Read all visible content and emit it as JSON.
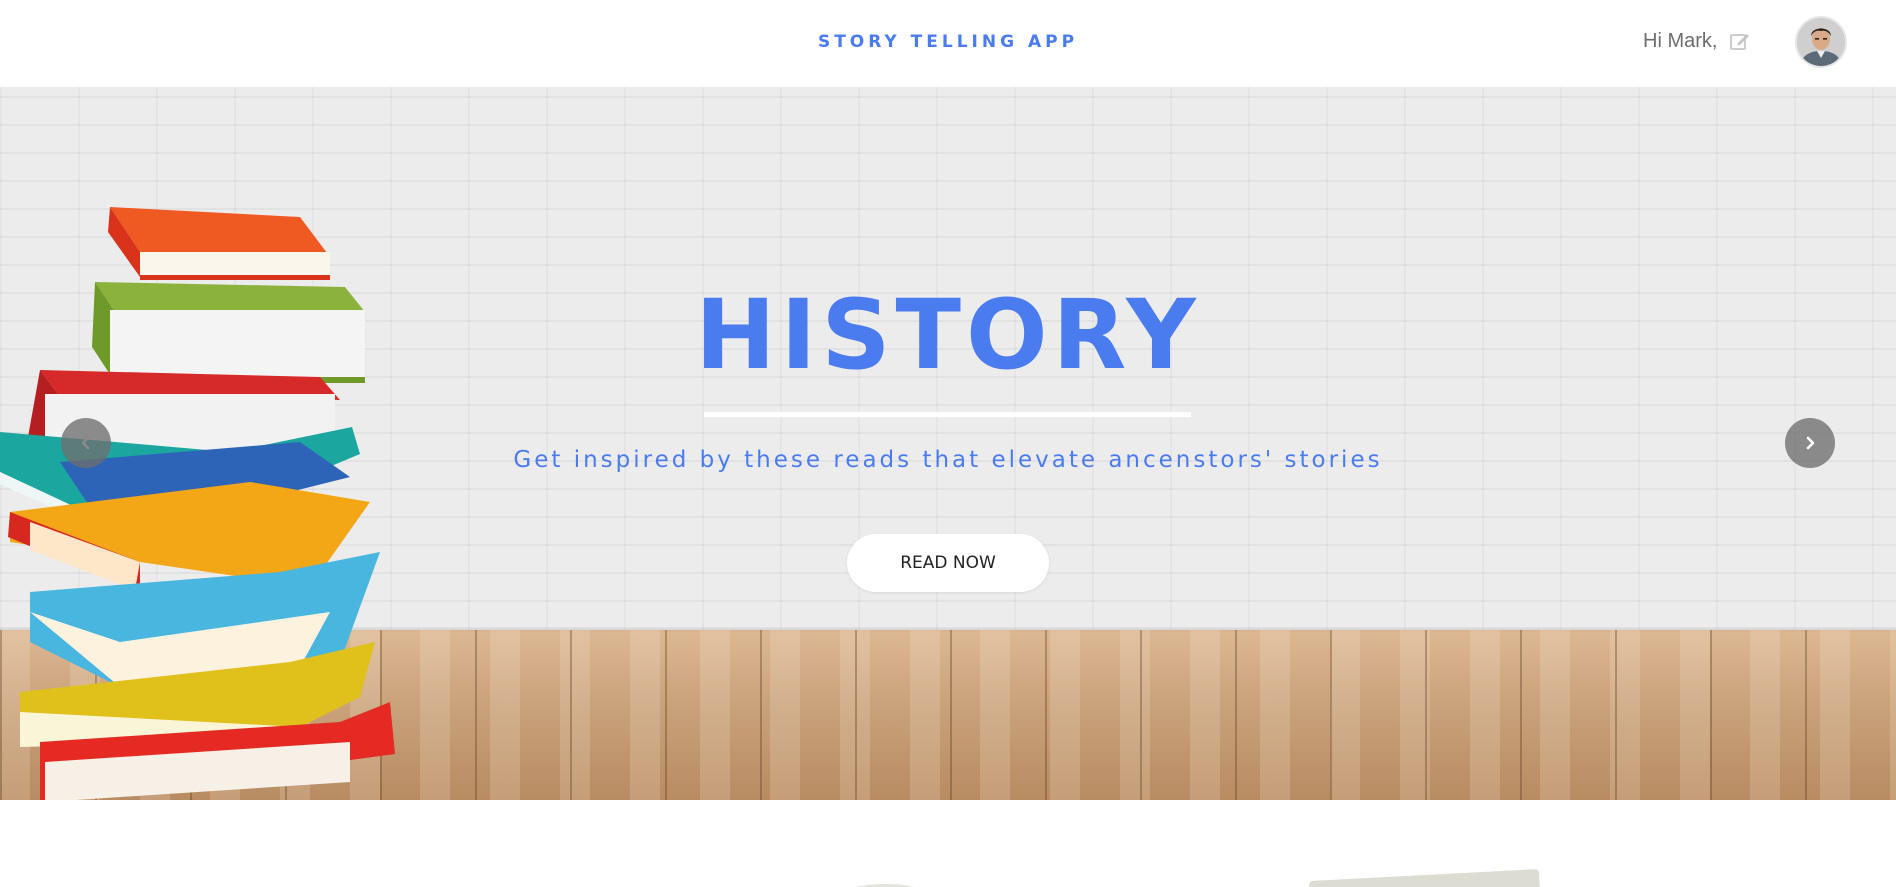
{
  "header": {
    "brand": "STORY TELLING APP",
    "greeting": "Hi Mark,",
    "edit_icon": "pencil-square-icon",
    "avatar": "user-avatar"
  },
  "hero": {
    "title": "HISTORY",
    "subtitle": "Get inspired by these reads that elevate ancenstors' stories",
    "button_label": "READ NOW",
    "prev_icon": "chevron-left-icon",
    "next_icon": "chevron-right-icon",
    "image": "stacked-books-illustration"
  },
  "colors": {
    "accent": "#4a7cf0",
    "greeting_text": "#6d6d6d",
    "wall": "#ececec",
    "floor": "#c8a07a",
    "carousel_button": "#6e6e6e"
  }
}
